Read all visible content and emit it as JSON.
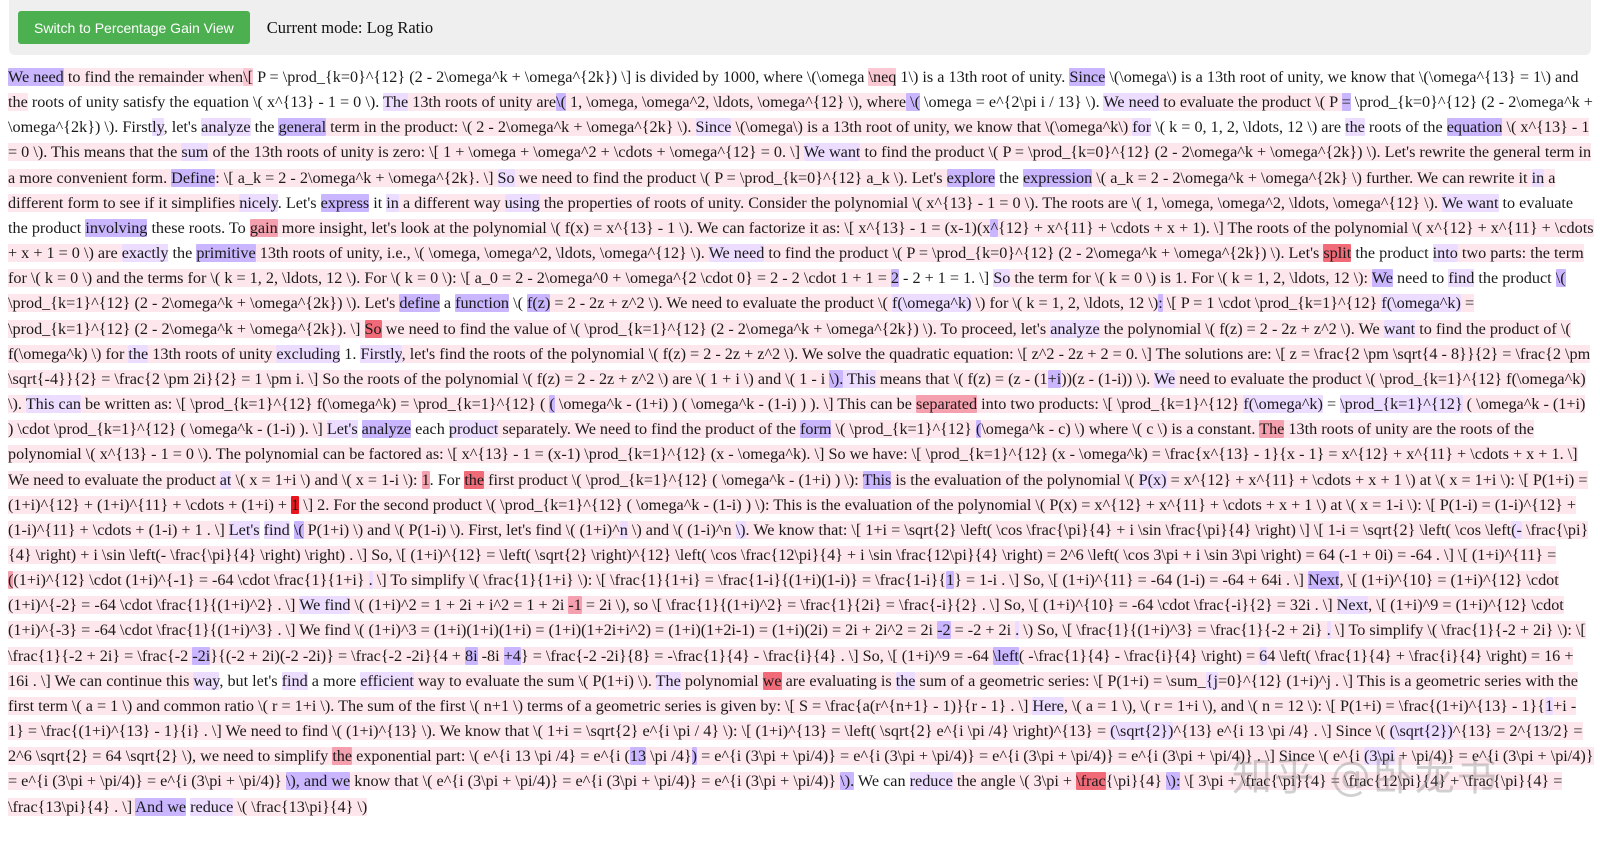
{
  "toolbar": {
    "button_label": "Switch to Percentage Gain View",
    "mode_label": "Current mode: Log Ratio"
  },
  "colors": {
    "button_bg": "#4caf50",
    "toolbar_bg": "#efefef",
    "highlight_blue_light": "#ecdcff",
    "highlight_blue_strong": "#c9b6ff",
    "highlight_pink_light": "#fde7ec",
    "highlight_pink_mid": "#fbc9d4",
    "highlight_red_light": "#f5a0ae",
    "highlight_red_mid": "#f06a78",
    "highlight_red_strong": "#e8161c"
  },
  "watermark": "知乎 @卧龙书",
  "tokens": [
    [
      "We need",
      "b2"
    ],
    [
      " to find the remainder when",
      "p1"
    ],
    [
      "\\[",
      "p2"
    ],
    [
      " P = \\prod_{k=0}^{12} (2 - 2\\omega^k + \\omega^{2k}) \\] is divided by 1000, where \\(\\omega ",
      ""
    ],
    [
      "\\neq",
      "p2"
    ],
    [
      " 1\\) is a 13th root of unity. ",
      ""
    ],
    [
      "Since",
      "b2"
    ],
    [
      " \\(\\omega\\) is a 13th root of unity, we know that \\(\\omega^{13} = 1\\) and ",
      ""
    ],
    [
      "the",
      "p1"
    ],
    [
      " roots of unity satisfy the equation \\( x^{13} - 1 = 0 \\). ",
      ""
    ],
    [
      "The",
      "b1"
    ],
    [
      " 13th roots of unity are",
      "p1"
    ],
    [
      "\\(",
      "b2"
    ],
    [
      " 1, \\omega, \\omega^2, \\ldots, \\omega^{12} \\), where",
      "p1"
    ],
    [
      " \\(",
      "b2"
    ],
    [
      " \\omega = e^{2\\pi i / 13} \\). ",
      ""
    ],
    [
      "We need",
      "b1"
    ],
    [
      " to evaluate the product \\( P ",
      "p1"
    ],
    [
      "=",
      "b2"
    ],
    [
      " \\prod_{k=0}^{12} (2 - 2\\omega^k + \\omega^{2k}) \\). First",
      ""
    ],
    [
      "ly",
      "b1"
    ],
    [
      ", let's ",
      ""
    ],
    [
      "analyze",
      "b1"
    ],
    [
      " the ",
      ""
    ],
    [
      "general",
      "b2"
    ],
    [
      " term in the product: \\( 2 - 2\\omega^k + \\omega^{2k} \\). ",
      "p1"
    ],
    [
      "Since",
      "b1"
    ],
    [
      " \\(\\omega\\) is a 13th root of unity, we know that \\(\\omega^k\\) ",
      "p1"
    ],
    [
      "for",
      "b1"
    ],
    [
      " \\( k = 0, 1, 2, \\ldots, 12 \\) are ",
      ""
    ],
    [
      "the",
      "b1"
    ],
    [
      " roots of the ",
      ""
    ],
    [
      "equation",
      "b2"
    ],
    [
      " \\( x^{13} - 1 = 0 \\). This means that the ",
      "p1"
    ],
    [
      "sum",
      "b1"
    ],
    [
      " of the 13th roots of unity is zero: \\[ 1 + \\omega + \\omega^2 + \\cdots + \\omega^{12} = 0. \\] ",
      "p1"
    ],
    [
      "We want",
      "b1"
    ],
    [
      " to find the product \\( P = \\prod_{k=0}^{12} (2 - 2\\omega^k + \\omega^{2k}) \\). Let's rewrite the general term in a more convenient form. ",
      "p1"
    ],
    [
      "Define",
      "b2"
    ],
    [
      ": \\[ a_k = 2 - 2\\omega^k + \\omega^{2k}. \\] ",
      "p1"
    ],
    [
      "So",
      "b1"
    ],
    [
      " we need to find the product \\( P = \\prod_{k=0}^{12} a_k \\). Let's ",
      "p1"
    ],
    [
      "explore",
      "b2"
    ],
    [
      " the ",
      ""
    ],
    [
      "expression",
      "b2"
    ],
    [
      " \\( a_k = 2 - 2\\omega^k + \\omega^{2k} \\) further. We can rewrite it ",
      "p1"
    ],
    [
      "in",
      "b1"
    ],
    [
      " a different form to see if it simplifies ",
      "p1"
    ],
    [
      "nicely",
      "b1"
    ],
    [
      ". Let's ",
      ""
    ],
    [
      "express",
      "b2"
    ],
    [
      " it ",
      ""
    ],
    [
      "in",
      "b1"
    ],
    [
      " a different way ",
      "p1"
    ],
    [
      "using",
      "b1"
    ],
    [
      " the properties of roots of unity. Consider the polynomial \\( x^{13} - 1 = 0 \\). The roots are \\( 1, \\omega, \\omega^2, \\ldots, \\omega^{12} \\). ",
      "p1"
    ],
    [
      "We want",
      "b1"
    ],
    [
      " to evaluate the product ",
      ""
    ],
    [
      "involving",
      "b2"
    ],
    [
      " these roots. To ",
      ""
    ],
    [
      "gain",
      "r1"
    ],
    [
      " more insight, let's look at the polynomial \\( f(x) = x^{13} - 1 \\). We can factorize it as: \\[ x^{13} - 1 = (x-1)(x",
      "p1"
    ],
    [
      "^",
      "b2"
    ],
    [
      "{12} + x^{11} + \\cdots + x + 1). \\] The roots of the polynomial \\( x^{12} + x^{11} + \\cdots + x + 1 = 0 \\) are ",
      "p1"
    ],
    [
      "exactly",
      "b1"
    ],
    [
      " the ",
      ""
    ],
    [
      "primitive",
      "b2"
    ],
    [
      " 13th roots of unity, i.e., \\( \\omega, \\omega^2, \\ldots, \\omega^{12} \\). ",
      "p1"
    ],
    [
      "We need",
      "b1"
    ],
    [
      " to find the product \\( P = \\prod_{k=0}^{12} (2 - 2\\omega^k + \\omega^{2k}) \\). Let's ",
      "p1"
    ],
    [
      "split",
      "r2"
    ],
    [
      " the product ",
      ""
    ],
    [
      "into",
      "b1"
    ],
    [
      " two parts: the term for \\( k = 0 \\) and the terms for \\( k = 1, 2, \\ldots, 12 \\). For \\( k = 0 \\): \\[ a_0 = 2 - 2\\omega^0 + \\omega^{2 \\cdot 0} = 2 - 2 \\cdot 1 + 1 = ",
      "p1"
    ],
    [
      "2",
      "b2"
    ],
    [
      " - 2 + 1 = 1. \\] ",
      ""
    ],
    [
      "So",
      "b1"
    ],
    [
      " the term for \\( k = 0 \\) is 1. For \\( k = 1, 2, \\ldots, 12 \\): ",
      "p1"
    ],
    [
      "We",
      "b2"
    ],
    [
      " need to ",
      ""
    ],
    [
      "find",
      "b1"
    ],
    [
      " the product ",
      ""
    ],
    [
      "\\(",
      "b2"
    ],
    [
      " \\prod_{k=1}^{12} (2 - 2\\omega^k + \\omega^{2k}) \\). Let's ",
      "p1"
    ],
    [
      "define",
      "b2"
    ],
    [
      " a ",
      ""
    ],
    [
      "function",
      "b2"
    ],
    [
      " \\( ",
      ""
    ],
    [
      "f(z)",
      "b2"
    ],
    [
      " = 2 - 2z + z^2 \\). We need to evaluate the product \\( ",
      "p1"
    ],
    [
      "f(\\omega^k)",
      "b1"
    ],
    [
      " \\) for \\( k = 1, 2, \\ldots, 12 \\)",
      "p1"
    ],
    [
      ":",
      "b2"
    ],
    [
      " \\[ P = 1 \\cdot \\prod_{k=1}^{12} ",
      "p1"
    ],
    [
      "f(\\omega^k)",
      "b1"
    ],
    [
      " = \\prod_{k=1}^{12} (2 - 2\\omega^k + \\omega^{2k}). \\] ",
      "p1"
    ],
    [
      "So",
      "r2"
    ],
    [
      " we need to find the value of \\( \\prod_{k=1}^{12} (2 - 2\\omega^k + \\omega^{2k}) \\). To proceed, let's ",
      "p1"
    ],
    [
      "analyze",
      "b1"
    ],
    [
      " the polynomial \\( f(z) = 2 - 2z + z^2 \\). We ",
      "p1"
    ],
    [
      "want",
      "b1"
    ],
    [
      " to find the product of \\( f(\\omega^k) \\) for ",
      "p1"
    ],
    [
      "the",
      "b1"
    ],
    [
      " 13th roots of unity ",
      "p1"
    ],
    [
      "excluding",
      "b1"
    ],
    [
      " 1. ",
      ""
    ],
    [
      "Firstly",
      "b1"
    ],
    [
      ", let's find the roots of the polynomial \\( f(z) = 2 - 2z + z^2 \\). We solve the quadratic equation: \\[ z^2 - 2z + 2 = 0. \\] The solutions are: \\[ z = \\frac{2 \\pm \\sqrt{4 - 8}}{2} = \\frac{2 \\pm \\sqrt{-4}}{2} = \\frac{2 \\pm 2i}{2} = 1 \\pm i. \\] So the roots of the polynomial \\( f(z) = 2 - 2z + z^2 \\) are \\( 1 + i \\) and \\( 1 - i ",
      "p1"
    ],
    [
      "\\).",
      "b2"
    ],
    [
      " This",
      "b1"
    ],
    [
      " means that \\( f(z) = (z - (1",
      "p1"
    ],
    [
      "+i",
      "b2"
    ],
    [
      "))(z - (1-i)) \\). ",
      "p1"
    ],
    [
      "We",
      "b1"
    ],
    [
      " need to evaluate the product \\( \\prod_{k=1}^{12} f(\\omega^k) \\). ",
      "p1"
    ],
    [
      "This",
      "b1"
    ],
    [
      " can",
      "b1"
    ],
    [
      " be written as: \\[ \\prod_{k=1}^{12} f(\\omega^k) = \\prod_{k=1}^{12} ( ",
      "p1"
    ],
    [
      "(",
      "b2"
    ],
    [
      " \\omega^k - (1+i) ) ( \\omega^k - (1-i) ) ). \\] This can be ",
      "p1"
    ],
    [
      "separated",
      "r1"
    ],
    [
      " into two products: \\[ \\prod_{k=1}^{12} ",
      "p1"
    ],
    [
      "f(\\omega^k)",
      "b1"
    ],
    [
      " = ",
      ""
    ],
    [
      "\\prod_{k=1}^{12}",
      "b1"
    ],
    [
      " ( \\omega^k - (1+i) ) \\cdot \\prod_{k=1}^{12} ( \\omega^k - (1-i) ). \\] ",
      "p1"
    ],
    [
      "Let's",
      "b1"
    ],
    [
      " ",
      ""
    ],
    [
      "analyze",
      "b2"
    ],
    [
      " each ",
      ""
    ],
    [
      "product",
      "b1"
    ],
    [
      " separately. We need to find the product of the ",
      "p1"
    ],
    [
      "form",
      "b2"
    ],
    [
      " \\( \\prod_{k=1}^{12} ",
      "p1"
    ],
    [
      "(",
      "b2"
    ],
    [
      "\\omega^k - c) \\) where \\( c \\) is a constant. ",
      "p1"
    ],
    [
      "The",
      "r1"
    ],
    [
      " 13th roots of unity are the roots of the polynomial \\( x^{13} - 1 = 0 \\). The polynomial can be factored as: \\[ x^{13} - 1 = (x-1) \\prod_{k=1}^{12} (x - \\omega^k). \\] So we have: \\[ \\prod_{k=1}^{12} (x - \\omega^k) = \\frac{x^{13} - 1}{x - 1} = x^{12} + x^{11} + \\cdots + x + 1. \\] We need to evaluate the product ",
      "p1"
    ],
    [
      "at",
      "b1"
    ],
    [
      " \\( x = 1+i \\) and \\( x = 1-i \\): ",
      "p1"
    ],
    [
      "1",
      "r1"
    ],
    [
      ". For ",
      ""
    ],
    [
      "the",
      "r2"
    ],
    [
      " first product \\( \\prod_{k=1}^{12} ( \\omega^k - (1+i) ) \\): ",
      "p1"
    ],
    [
      "This",
      "b2"
    ],
    [
      " is the evaluation of the polynomial \\( ",
      "p1"
    ],
    [
      "P(x)",
      "b1"
    ],
    [
      " = x^{12} + x^{11} + \\cdots + x + 1 \\) at \\( x = 1+i \\): \\[ P(1+i) = (1+i)^{12} + (1+i)^{11} + \\cdots + (1+i) + ",
      "p1"
    ],
    [
      "1",
      "r3"
    ],
    [
      " \\] 2. For the second product \\( \\prod_{k=1}^{12} ( \\omega^k - (1-i) ) \\): This is the evaluation of the polynomial \\( P(x) = x^{12} + x^{11} + \\cdots + x + 1 \\) at \\( x = 1-i \\): \\[ P(1-i) = (1-i)^{12} + (1-i)^{11} + \\cdots + (1-i) + 1 . \\] ",
      "p1"
    ],
    [
      "Let's",
      "b1"
    ],
    [
      " ",
      ""
    ],
    [
      "find",
      "b1"
    ],
    [
      " ",
      ""
    ],
    [
      "\\(",
      "b2"
    ],
    [
      " P(1+i) \\) and \\( P(1-i) \\). First, let's find \\( (1+i)^",
      "p1"
    ],
    [
      "n",
      "b1"
    ],
    [
      " \\) and \\( (1-i)^n ",
      "p1"
    ],
    [
      "\\)",
      "b1"
    ],
    [
      ". We know that: \\[ 1+i = \\sqrt{2} \\left( \\cos \\frac{\\pi}{4} + i \\sin \\frac{\\pi}{4} \\right) \\] \\[ 1-i = \\sqrt{2} \\left( \\cos \\left",
      "p1"
    ],
    [
      "(-",
      "b1"
    ],
    [
      " \\frac{\\pi}{4} \\right) + i \\sin \\left(- \\frac{\\pi}{4} \\right) \\right) . \\] So, \\[ (1+i)^{12} = \\left( \\sqrt{2} \\right)^{12} \\left( \\cos \\frac{12\\pi}{4} + i \\sin \\frac{12\\pi}{4} \\right) = 2^6 \\left( \\cos 3\\pi + i \\sin 3\\pi \\right) = 64 (-1 + 0i) = -64 . \\] \\[ (1+i)^{11} = ",
      "p1"
    ],
    [
      "(",
      "r1"
    ],
    [
      "(1+i)^{12} \\cdot (1+i)^{-1} = -64 \\cdot \\frac{1}{1+i} ",
      "p1"
    ],
    [
      ".",
      "b1"
    ],
    [
      " \\] To simplify \\( \\frac{1}{1+i} \\): \\[ \\frac{1}{1+i} = \\frac{1-i}{(1+i)(1-i)} = \\frac{1-i}{",
      "p1"
    ],
    [
      "1",
      "b2"
    ],
    [
      "} = 1-i . \\] So, \\[ (1+i)^{11} = -64 (1-i) = -64 + 64i . \\] ",
      "p1"
    ],
    [
      "Next",
      "b2"
    ],
    [
      ", \\[ (1+i)^{10} = (1+i)^{12} \\cdot (1+i)^{-2} = -64 \\cdot \\frac{1}{(1+i)^2} . \\] ",
      "p1"
    ],
    [
      "We find",
      "b1"
    ],
    [
      " \\( (1+i)^2 = 1 + 2i + i^2 = 1 + 2i ",
      "p1"
    ],
    [
      "-1",
      "r1"
    ],
    [
      " = 2i \\), so \\[ \\frac{1}{(1+i)^2} = \\frac{1}{2i} = \\frac{-i}{2} . \\] So, \\[ (1+i)^{10} = -64 \\cdot \\frac{-i}{2} = 32i . \\] ",
      "p1"
    ],
    [
      "Next",
      "b1"
    ],
    [
      ", \\[ (1+i)^9 = (1+i)^{12} \\cdot (1+i)^{-3} = -64 \\cdot \\frac{1}{(1+i)^3} . \\] We find \\( (1+i)^3 = (1+i)(1+i)(1+i) = (1+i)(1+2i+i^2) = (1+i)(1+2i-1) = (1+i)(2i) = 2i + 2i^2 = 2i ",
      "p1"
    ],
    [
      "-2",
      "b2"
    ],
    [
      " = -2 + 2i ",
      "p1"
    ],
    [
      ".",
      "b1"
    ],
    [
      " \\) So, \\[ \\frac{1}{(1+i)^3} = \\frac{1}{-2 + 2i} ",
      "p1"
    ],
    [
      ".",
      "b1"
    ],
    [
      " \\] To simplify \\( \\frac{1}{-2 + 2i} \\): \\[ \\frac{1}{-2 + 2i} = \\frac{-2 ",
      "p1"
    ],
    [
      "-2i",
      "b2"
    ],
    [
      "}{(-2 + 2i)(-2 -2i)} = \\frac{-2 -2i}{4 + ",
      "p1"
    ],
    [
      "8i",
      "b2"
    ],
    [
      " -8i ",
      "p1"
    ],
    [
      "+4",
      "b2"
    ],
    [
      "} = \\frac{-2 -2i}{8} = -\\frac{1}{4} - \\frac{i}{4} . \\] So, \\[ (1+i)^9 = -64 ",
      "p1"
    ],
    [
      "\\left",
      "b2"
    ],
    [
      "( -\\frac{1}{4} - \\frac{i}{4} \\right) = ",
      "p1"
    ],
    [
      "6",
      "b1"
    ],
    [
      "4 \\left( \\frac{1}{4} + \\frac{i}{4} \\right) = 16 + 16i . \\] We can continue this ",
      "p1"
    ],
    [
      "way",
      "b1"
    ],
    [
      ", but let's ",
      ""
    ],
    [
      "find",
      "b1"
    ],
    [
      " a more ",
      ""
    ],
    [
      "efficient",
      "b1"
    ],
    [
      " way to evaluate the sum \\( P(1+i) \\). ",
      "p1"
    ],
    [
      "The",
      "b1"
    ],
    [
      " polynomial ",
      "p1"
    ],
    [
      "we",
      "r2"
    ],
    [
      " are evaluating is ",
      "p1"
    ],
    [
      "the",
      "b1"
    ],
    [
      " sum of a geometric series: \\[ P(1+i) = \\sum_",
      "p1"
    ],
    [
      "{j",
      "b1"
    ],
    [
      "=0}^{12} (1+i)^j . \\] This is a geometric series with the first term \\( a = 1 \\) and common ratio \\( r = 1+i \\). The sum of the first \\( n+1 \\) terms of a geometric series is given by: \\[ S = \\frac{a(r^{n+1} - 1)}{r - 1} . \\] ",
      "p1"
    ],
    [
      "Here",
      "b1"
    ],
    [
      ", \\( a = 1 \\), \\( r = 1+i \\), and \\( n = 12 \\): \\[ P(1+i) = \\frac{(1+i)^{13} - 1}{",
      "p1"
    ],
    [
      "1",
      "b1"
    ],
    [
      "+i - 1} = \\frac{(1+i)^{13} - 1}{i} . \\] We need to find \\( (1+i)^{13} \\). We know that \\( 1+i = \\sqrt{2} e^{i \\pi / 4} \\): \\[ (1+i)^{13} = \\left( \\sqrt{2} e^{i \\pi /4} \\right)^{13} = ",
      "p1"
    ],
    [
      "(\\sqrt{2})",
      "b1"
    ],
    [
      "^{13} e^{i 13 \\pi /4} . \\] Since \\( ",
      "p1"
    ],
    [
      "(\\sqrt{2})",
      "b1"
    ],
    [
      "^{13} = 2^{13/2} = 2^6 \\sqrt{2} = 64 \\sqrt{2} \\), we need to simplify ",
      "p1"
    ],
    [
      "the",
      "r1"
    ],
    [
      " exponential part: \\( e^{i 13 \\pi /4} = e^{i (",
      "p1"
    ],
    [
      "13",
      "b2"
    ],
    [
      " \\pi /4}",
      "p1"
    ],
    [
      ")",
      "b2"
    ],
    [
      " = e^{i (3\\pi + \\pi/4)} = e^{i (3\\pi + \\pi/4)} = e^{i (3\\pi + \\pi/4)} = e^{i (3\\pi + \\pi/4)} . \\] Since \\( e^{i ",
      "p1"
    ],
    [
      "(3\\pi",
      "b1"
    ],
    [
      " + \\pi/4)} = e^{i (3\\pi + \\pi/4)} = e^{i (3\\pi + \\pi/4)} = e^{i (3\\pi + \\pi/4)} ",
      "p1"
    ],
    [
      "\\), and we",
      "b2"
    ],
    [
      " know that \\( e^{i (3\\pi + \\pi/4)} = e^{i (3\\pi + \\pi/4)} = e^{i (3\\pi + \\pi/4)} ",
      "p1"
    ],
    [
      "\\).",
      "b2"
    ],
    [
      " We can ",
      ""
    ],
    [
      "reduce",
      "b1"
    ],
    [
      " the angle \\( 3\\pi + ",
      "p1"
    ],
    [
      "\\frac",
      "r2"
    ],
    [
      "{\\pi}{4} ",
      "p1"
    ],
    [
      "\\):",
      "b2"
    ],
    [
      " \\[ 3\\pi + \\frac{\\pi}{4} = \\frac{12\\pi}{4} + \\frac{\\pi}{4} = \\frac{13\\pi}{4} . \\] ",
      "p1"
    ],
    [
      "And we",
      "b2"
    ],
    [
      " ",
      ""
    ],
    [
      "reduce",
      "b1"
    ],
    [
      " \\( \\frac{13\\pi}{4} \\)",
      "p1"
    ]
  ]
}
